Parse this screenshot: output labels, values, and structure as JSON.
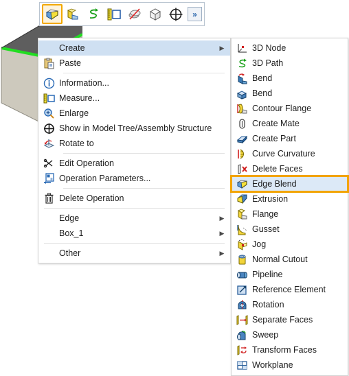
{
  "app": {
    "background_color": "#ffffff",
    "highlight_color": "#f2a400",
    "menu_hover_color": "#cfe0f2"
  },
  "model": {
    "name": "box-3d-model",
    "highlighted_edge_color": "#22dd22",
    "top_face_color": "#5e5e5e",
    "side_face_color": "#cdc9bd",
    "front_face_color": "#c2bfb3"
  },
  "toolbar": {
    "name": "modeling-toolbar",
    "buttons": [
      {
        "name": "edge-blend-tool",
        "icon": "edge-blend-icon",
        "selected": true
      },
      {
        "name": "flange-tool",
        "icon": "flange-icon",
        "selected": false
      },
      {
        "name": "path-3d-tool",
        "icon": "3d-path-icon",
        "selected": false
      },
      {
        "name": "measure-tool",
        "icon": "measure-icon",
        "selected": false
      },
      {
        "name": "hide-tool",
        "icon": "hide-icon",
        "selected": false
      },
      {
        "name": "cube-view-tool",
        "icon": "cube-icon",
        "selected": false
      },
      {
        "name": "center-tool",
        "icon": "crosshair-icon",
        "selected": false
      }
    ],
    "overflow_label": "»"
  },
  "context_menu": {
    "name": "context-menu",
    "items": [
      {
        "label": "Create",
        "icon": "",
        "submenu": true,
        "highlighted": true,
        "sep_after": false
      },
      {
        "label": "Paste",
        "icon": "paste-icon",
        "submenu": false,
        "highlighted": false,
        "sep_after": true
      },
      {
        "label": "Information...",
        "icon": "information-icon",
        "submenu": false,
        "highlighted": false,
        "sep_after": false
      },
      {
        "label": "Measure...",
        "icon": "measure-icon",
        "submenu": false,
        "highlighted": false,
        "sep_after": false
      },
      {
        "label": "Enlarge",
        "icon": "enlarge-icon",
        "submenu": false,
        "highlighted": false,
        "sep_after": false
      },
      {
        "label": "Show in Model Tree/Assembly Structure",
        "icon": "show-in-tree-icon",
        "submenu": false,
        "highlighted": false,
        "sep_after": false
      },
      {
        "label": "Rotate to",
        "icon": "rotate-to-icon",
        "submenu": false,
        "highlighted": false,
        "sep_after": true
      },
      {
        "label": "Edit Operation",
        "icon": "edit-operation-icon",
        "submenu": false,
        "highlighted": false,
        "sep_after": false
      },
      {
        "label": "Operation Parameters...",
        "icon": "operation-parameters-icon",
        "submenu": false,
        "highlighted": false,
        "sep_after": true
      },
      {
        "label": "Delete Operation",
        "icon": "delete-operation-icon",
        "submenu": false,
        "highlighted": false,
        "sep_after": true
      },
      {
        "label": "Edge",
        "icon": "",
        "submenu": true,
        "highlighted": false,
        "sep_after": false
      },
      {
        "label": "Box_1",
        "icon": "",
        "submenu": true,
        "highlighted": false,
        "sep_after": true
      },
      {
        "label": "Other",
        "icon": "",
        "submenu": true,
        "highlighted": false,
        "sep_after": false
      }
    ]
  },
  "create_submenu": {
    "name": "create-submenu",
    "items": [
      {
        "label": "3D Node",
        "icon": "3d-node-icon",
        "selected": false
      },
      {
        "label": "3D Path",
        "icon": "3d-path-icon",
        "selected": false
      },
      {
        "label": "Bend",
        "icon": "bend-red-icon",
        "selected": false
      },
      {
        "label": "Bend",
        "icon": "bend-blue-icon",
        "selected": false
      },
      {
        "label": "Contour Flange",
        "icon": "contour-flange-icon",
        "selected": false
      },
      {
        "label": "Create Mate",
        "icon": "create-mate-icon",
        "selected": false
      },
      {
        "label": "Create Part",
        "icon": "create-part-icon",
        "selected": false
      },
      {
        "label": "Curve Curvature",
        "icon": "curve-curvature-icon",
        "selected": false
      },
      {
        "label": "Delete Faces",
        "icon": "delete-faces-icon",
        "selected": false
      },
      {
        "label": "Edge Blend",
        "icon": "edge-blend-icon",
        "selected": true
      },
      {
        "label": "Extrusion",
        "icon": "extrusion-icon",
        "selected": false
      },
      {
        "label": "Flange",
        "icon": "flange-icon",
        "selected": false
      },
      {
        "label": "Gusset",
        "icon": "gusset-icon",
        "selected": false
      },
      {
        "label": "Jog",
        "icon": "jog-icon",
        "selected": false
      },
      {
        "label": "Normal Cutout",
        "icon": "normal-cutout-icon",
        "selected": false
      },
      {
        "label": "Pipeline",
        "icon": "pipeline-icon",
        "selected": false
      },
      {
        "label": "Reference Element",
        "icon": "reference-element-icon",
        "selected": false
      },
      {
        "label": "Rotation",
        "icon": "rotation-icon",
        "selected": false
      },
      {
        "label": "Separate Faces",
        "icon": "separate-faces-icon",
        "selected": false
      },
      {
        "label": "Sweep",
        "icon": "sweep-icon",
        "selected": false
      },
      {
        "label": "Transform Faces",
        "icon": "transform-faces-icon",
        "selected": false
      },
      {
        "label": "Workplane",
        "icon": "workplane-icon",
        "selected": false
      }
    ]
  }
}
